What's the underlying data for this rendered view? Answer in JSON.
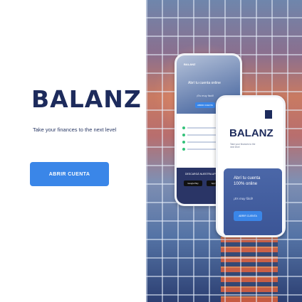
{
  "left": {
    "brand": "BALANZ",
    "tagline": "Take your finances to the next level",
    "cta_label": "ABRIR CUENTA"
  },
  "phone_back": {
    "logo": "BALANZ",
    "caption": "Abrí tu cuenta online",
    "small": "¡Es muy fácil!",
    "button": "ABRIR CUENTA",
    "dark_title": "DESCARGÁ NUESTRA APP",
    "store1": "Google Play",
    "store2": "App Store"
  },
  "phone_front": {
    "logo": "BALANZ",
    "subtitle": "Take your finances to the next level",
    "caption1": "Abrí tu cuenta",
    "caption2": "100% online",
    "easy": "¡Es muy fácil!",
    "button": "ABRIR CUENTA"
  },
  "colors": {
    "brand": "#1d2b5c",
    "accent": "#3a86e8"
  }
}
